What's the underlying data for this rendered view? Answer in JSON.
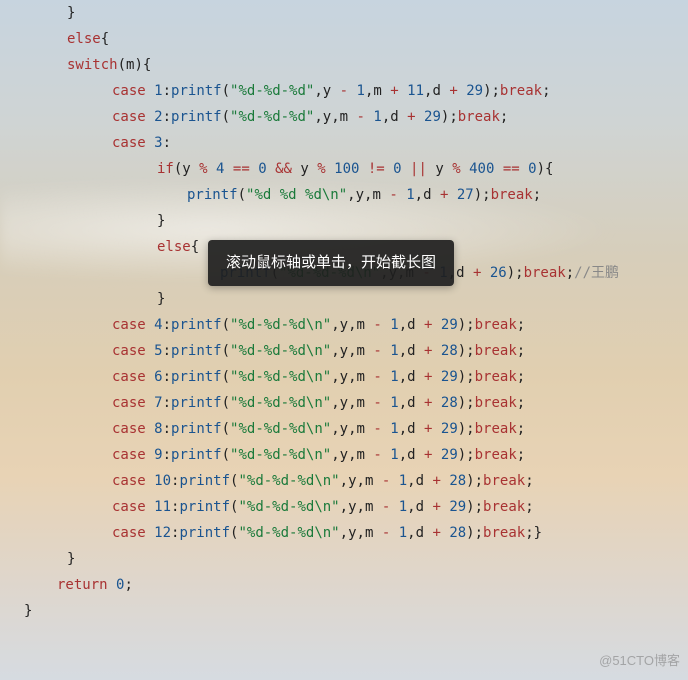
{
  "tooltip": "滚动鼠标轴或单击，开始截长图",
  "watermark": "@51CTO博客",
  "code": {
    "else": "else",
    "switch": "switch",
    "case": "case",
    "if": "if",
    "return": "return",
    "break": "break",
    "printf": "printf",
    "m": "m",
    "y": "y",
    "d": "d",
    "fmt1": "\"%d-%d-%d\"",
    "fmt2": "\"%d-%d-%d\\n\"",
    "fmt3": "\"%d %d %d\\n\"",
    "n0": "0",
    "n1": "1",
    "n2": "2",
    "n3": "3",
    "n4": "4",
    "n5": "5",
    "n6": "6",
    "n7": "7",
    "n8": "8",
    "n9": "9",
    "n10": "10",
    "n11": "11",
    "n12": "12",
    "n26": "26",
    "n27": "27",
    "n28": "28",
    "n29": "29",
    "n100": "100",
    "n400": "400",
    "comment": "//王鹏"
  }
}
